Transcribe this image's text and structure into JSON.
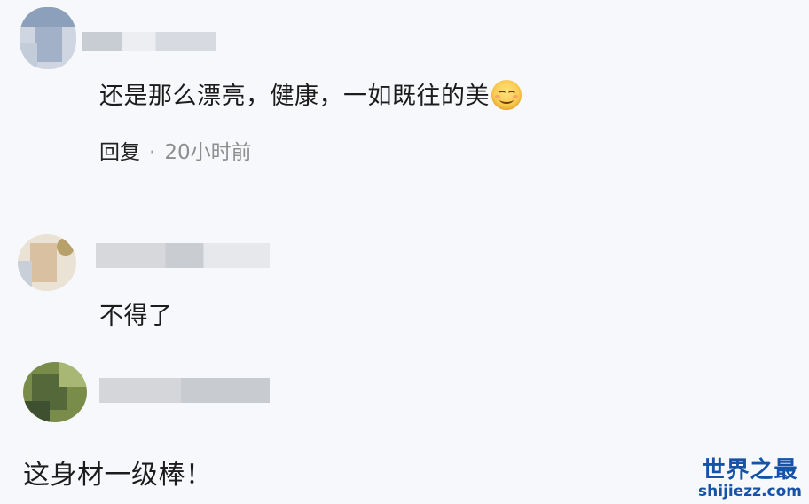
{
  "comments": [
    {
      "text": "还是那么漂亮，健康，一如既往的美",
      "emoji": "smile-emoji",
      "reply_label": "回复",
      "separator": "·",
      "time": "20小时前"
    },
    {
      "text": "不得了"
    },
    {
      "text": "这身材一级棒！"
    }
  ],
  "watermark": {
    "title": "世界之最",
    "url": "shijiezz.com"
  },
  "colors": {
    "background": "#f7f8fb",
    "watermark": "#1552a8",
    "time": "#8e8e8e"
  }
}
